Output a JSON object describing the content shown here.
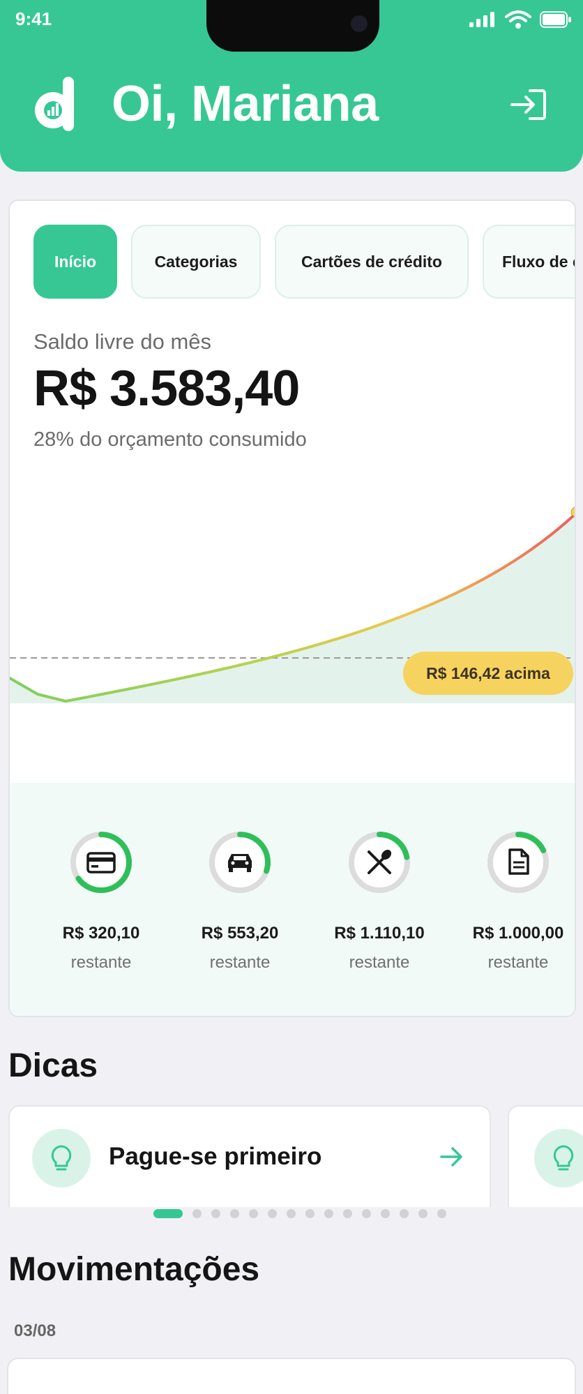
{
  "status_bar": {
    "time": "9:41"
  },
  "header": {
    "greeting": "Oi, Mariana"
  },
  "tabs": [
    {
      "label": "Início",
      "active": true
    },
    {
      "label": "Categorias",
      "active": false
    },
    {
      "label": "Cartões de crédito",
      "active": false
    },
    {
      "label": "Fluxo de c",
      "active": false
    }
  ],
  "summary": {
    "label": "Saldo livre do mês",
    "value": "R$ 3.583,40",
    "budget_text": "28% do orçamento consumido"
  },
  "chart_data": {
    "type": "area",
    "badge": "R$ 146,42 acima"
  },
  "categories": [
    {
      "icon": "credit-card-icon",
      "amount": "R$ 320,10",
      "sub": "restante",
      "progress": 0.65
    },
    {
      "icon": "car-icon",
      "amount": "R$ 553,20",
      "sub": "restante",
      "progress": 0.3
    },
    {
      "icon": "utensils-icon",
      "amount": "R$ 1.110,10",
      "sub": "restante",
      "progress": 0.22
    },
    {
      "icon": "document-icon",
      "amount": "R$ 1.000,00",
      "sub": "restante",
      "progress": 0.18
    }
  ],
  "tips": {
    "title": "Dicas",
    "items": [
      {
        "text": "Pague-se primeiro"
      }
    ],
    "page_count": 15,
    "active_page": 0
  },
  "movements": {
    "title": "Movimentações",
    "date": "03/08"
  },
  "colors": {
    "accent": "#36c794",
    "badge": "#f6d35f",
    "ring_track": "#dcdcdc"
  }
}
